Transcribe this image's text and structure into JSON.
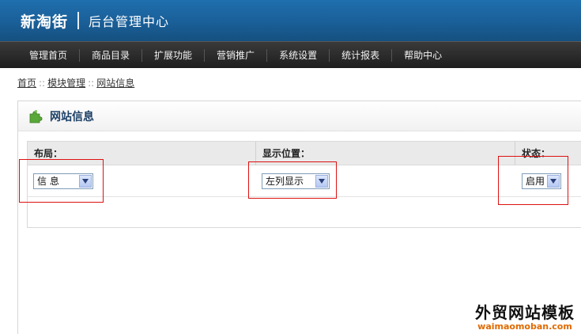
{
  "header": {
    "brand": "新淘街",
    "subtitle": "后台管理中心"
  },
  "nav": {
    "items": [
      "管理首页",
      "商品目录",
      "扩展功能",
      "营销推广",
      "系统设置",
      "统计报表",
      "帮助中心"
    ]
  },
  "breadcrumb": {
    "items": [
      "首页",
      "模块管理",
      "网站信息"
    ],
    "separator": "::"
  },
  "panel": {
    "title": "网站信息",
    "icon": "puzzle-icon",
    "columns": [
      "布局：",
      "显示位置：",
      "状态："
    ],
    "row": {
      "layout": "信 息",
      "position": "左列显示",
      "status": "启用"
    }
  },
  "watermark": {
    "cn": "外贸网站模板",
    "en": "waimaomoban.com"
  },
  "colors": {
    "header": "#1a5f98",
    "nav": "#2b2b2b",
    "title": "#1b3f66",
    "highlight": "#dd1111",
    "watermark_en": "#e06a00"
  }
}
